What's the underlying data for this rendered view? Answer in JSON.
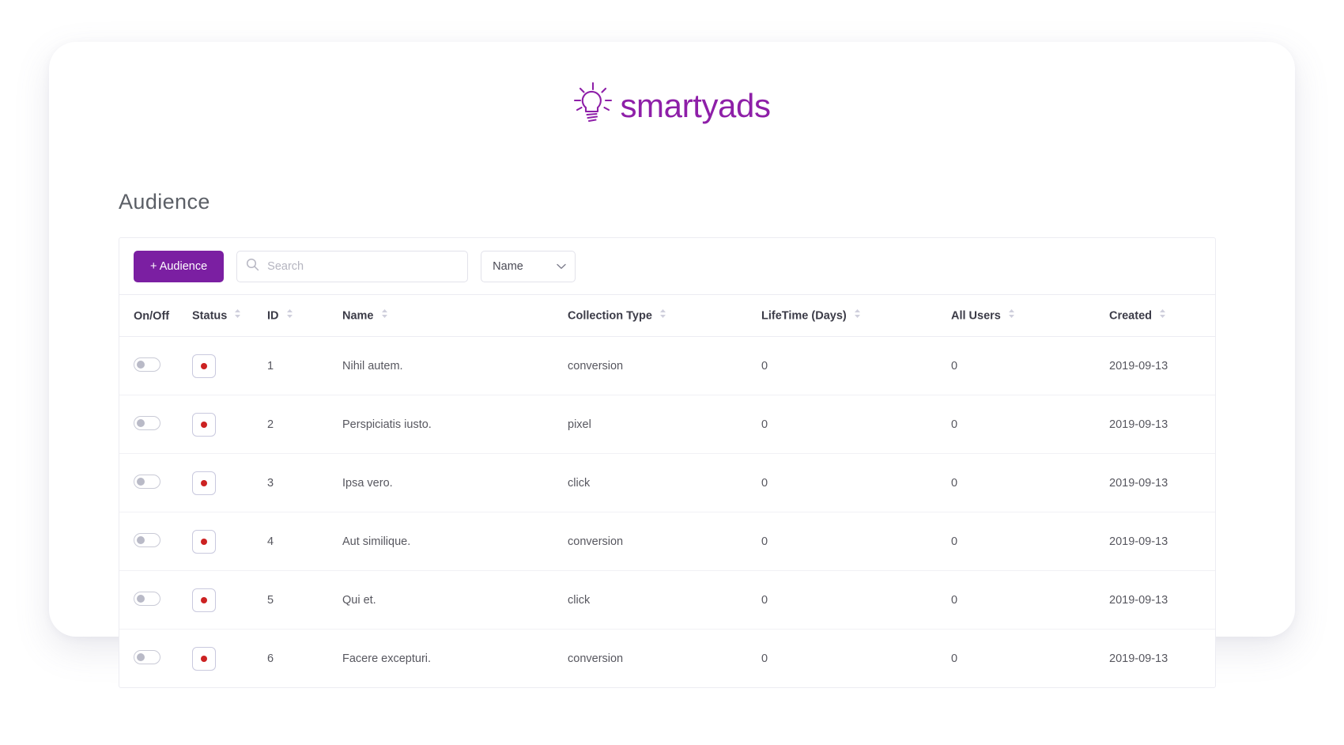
{
  "brand": {
    "wordmark": "smartyads",
    "icon": "lightbulb-icon",
    "color": "#8e1fa8"
  },
  "page": {
    "title": "Audience"
  },
  "toolbar": {
    "add_button_label": "+ Audience",
    "search": {
      "placeholder": "Search",
      "value": "",
      "icon": "search-icon"
    },
    "sort_select": {
      "selected": "Name",
      "options": [
        "Name"
      ],
      "icon": "chevron-down-icon"
    }
  },
  "table": {
    "columns": [
      {
        "key": "onoff",
        "label": "On/Off",
        "sortable": false
      },
      {
        "key": "status",
        "label": "Status",
        "sortable": true
      },
      {
        "key": "id",
        "label": "ID",
        "sortable": true
      },
      {
        "key": "name",
        "label": "Name",
        "sortable": true
      },
      {
        "key": "ctype",
        "label": "Collection Type",
        "sortable": true
      },
      {
        "key": "life",
        "label": "LifeTime (Days)",
        "sortable": true
      },
      {
        "key": "users",
        "label": "All Users",
        "sortable": true
      },
      {
        "key": "created",
        "label": "Created",
        "sortable": true
      }
    ],
    "rows": [
      {
        "onoff": false,
        "status": "inactive",
        "id": "1",
        "name": "Nihil autem.",
        "ctype": "conversion",
        "life": "0",
        "users": "0",
        "created": "2019-09-13"
      },
      {
        "onoff": false,
        "status": "inactive",
        "id": "2",
        "name": "Perspiciatis iusto.",
        "ctype": "pixel",
        "life": "0",
        "users": "0",
        "created": "2019-09-13"
      },
      {
        "onoff": false,
        "status": "inactive",
        "id": "3",
        "name": "Ipsa vero.",
        "ctype": "click",
        "life": "0",
        "users": "0",
        "created": "2019-09-13"
      },
      {
        "onoff": false,
        "status": "inactive",
        "id": "4",
        "name": "Aut similique.",
        "ctype": "conversion",
        "life": "0",
        "users": "0",
        "created": "2019-09-13"
      },
      {
        "onoff": false,
        "status": "inactive",
        "id": "5",
        "name": "Qui et.",
        "ctype": "click",
        "life": "0",
        "users": "0",
        "created": "2019-09-13"
      },
      {
        "onoff": false,
        "status": "inactive",
        "id": "6",
        "name": "Facere excepturi.",
        "ctype": "conversion",
        "life": "0",
        "users": "0",
        "created": "2019-09-13"
      }
    ]
  },
  "colors": {
    "brand_purple": "#8e1fa8",
    "button_purple": "#7b1fa2",
    "status_red": "#cc2222",
    "border": "#ececf2",
    "text": "#57575f"
  }
}
